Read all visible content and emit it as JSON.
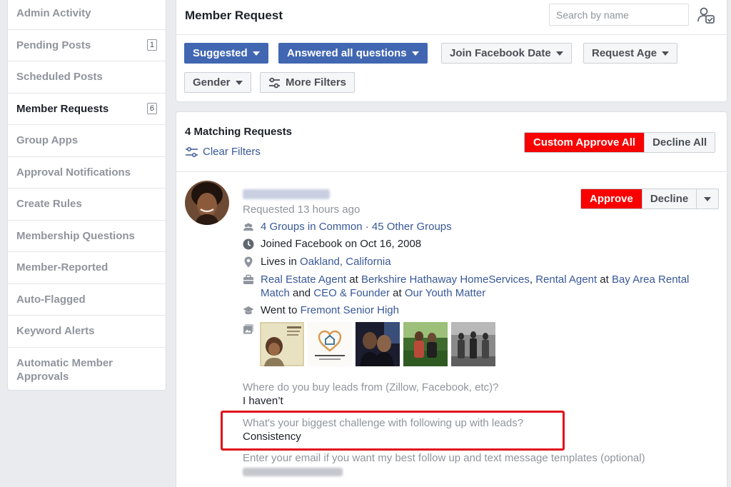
{
  "sidebar": {
    "items": [
      {
        "label": "Admin Activity",
        "badge": ""
      },
      {
        "label": "Pending Posts",
        "badge": "1"
      },
      {
        "label": "Scheduled Posts",
        "badge": ""
      },
      {
        "label": "Member Requests",
        "badge": "6"
      },
      {
        "label": "Group Apps",
        "badge": ""
      },
      {
        "label": "Approval Notifications",
        "badge": ""
      },
      {
        "label": "Create Rules",
        "badge": ""
      },
      {
        "label": "Membership Questions",
        "badge": ""
      },
      {
        "label": "Member-Reported",
        "badge": ""
      },
      {
        "label": "Auto-Flagged",
        "badge": ""
      },
      {
        "label": "Keyword Alerts",
        "badge": ""
      },
      {
        "label": "Automatic Member Approvals",
        "badge": ""
      }
    ],
    "active_index": 3
  },
  "header": {
    "title": "Member Request",
    "search_placeholder": "Search by name",
    "filters": {
      "suggested": "Suggested",
      "answered": "Answered all questions",
      "join_date": "Join Facebook Date",
      "request_age": "Request Age",
      "gender": "Gender",
      "more": "More Filters"
    }
  },
  "results": {
    "count_label": "4 Matching Requests",
    "clear_filters": "Clear Filters",
    "custom_approve_all": "Custom Approve All",
    "decline_all": "Decline All"
  },
  "request": {
    "requested": "Requested 13 hours ago",
    "approve": "Approve",
    "decline": "Decline",
    "groups_common": "4 Groups in Common",
    "separator": " · ",
    "other_groups": "45 Other Groups",
    "joined": "Joined Facebook on Oct 16, 2008",
    "lives_prefix": "Lives in ",
    "lives_place": "Oakland, California",
    "work": {
      "job1": "Real Estate Agent",
      "at1": " at ",
      "company1": "Berkshire Hathaway HomeServices",
      "comma": ", ",
      "job2": "Rental Agent",
      "at2": " at ",
      "company2a": "Bay Area Rental",
      "company2b": "Match",
      "and": " and ",
      "job3": "CEO & Founder",
      "at3": " at ",
      "company3": "Our Youth Matter"
    },
    "education_prefix": "Went to ",
    "school": "Fremont Senior High",
    "questions": [
      {
        "q": "Where do you buy leads from (Zillow, Facebook, etc)?",
        "a": "I haven’t"
      },
      {
        "q": "What's your biggest challenge with following up with leads?",
        "a": "Consistency"
      },
      {
        "q": "Enter your email if you want my best follow up and text message templates (optional)",
        "a": ""
      }
    ]
  },
  "colors": {
    "primary_blue": "#4267b2",
    "link_blue": "#385898",
    "approve_red": "#fa0000",
    "highlight_red": "#e0111b"
  }
}
